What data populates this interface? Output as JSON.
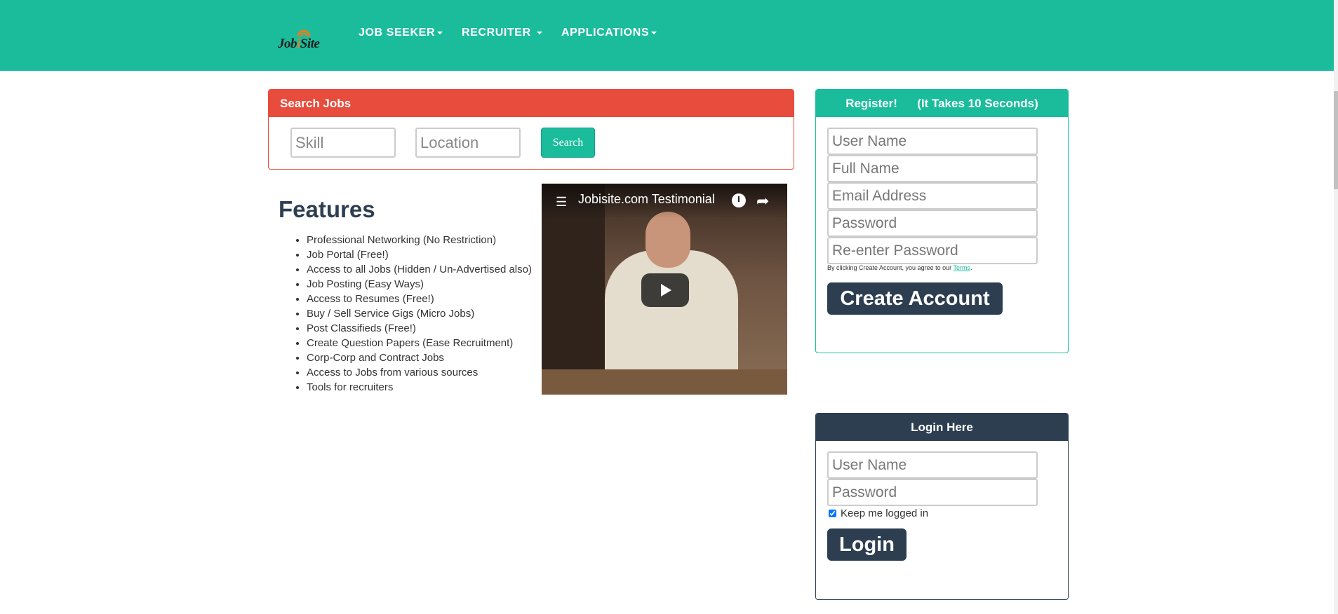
{
  "logo": {
    "text_a": "Job",
    "text_i": "i",
    "text_b": "Site"
  },
  "nav": {
    "items": [
      {
        "label": "JOB SEEKER"
      },
      {
        "label": "RECRUITER "
      },
      {
        "label": "APPLICATIONS"
      }
    ]
  },
  "search": {
    "title": "Search Jobs",
    "skill_placeholder": "Skill",
    "location_placeholder": "Location",
    "button": "Search"
  },
  "features": {
    "title": "Features",
    "items": [
      "Professional Networking (No Restriction)",
      "Job Portal (Free!)",
      "Access to all Jobs (Hidden / Un-Advertised also)",
      "Job Posting (Easy Ways)",
      "Access to Resumes (Free!)",
      "Buy / Sell Service Gigs (Micro Jobs)",
      "Post Classifieds (Free!)",
      "Create Question Papers (Ease Recruitment)",
      "Corp-Corp and Contract Jobs",
      "Access to Jobs from various sources",
      "Tools for recruiters"
    ]
  },
  "video": {
    "title": "Jobisite.com Testimonial"
  },
  "register": {
    "title": "Register!      (It Takes 10 Seconds)",
    "username_placeholder": "User Name",
    "fullname_placeholder": "Full Name",
    "email_placeholder": "Email Address",
    "password_placeholder": "Password",
    "repassword_placeholder": "Re-enter Password",
    "terms_text": "By clicking Create Account, you agree to our ",
    "terms_link": "Terms",
    "terms_end": ".",
    "button": "Create Account"
  },
  "login": {
    "title": "Login Here",
    "username_placeholder": "User Name",
    "password_placeholder": "Password",
    "keep_label": "Keep me logged in",
    "keep_checked": true,
    "button": "Login"
  },
  "colors": {
    "primary": "#1abc9c",
    "danger": "#e74c3c",
    "dark": "#2c3e50",
    "logo_accent": "#e67e22"
  }
}
